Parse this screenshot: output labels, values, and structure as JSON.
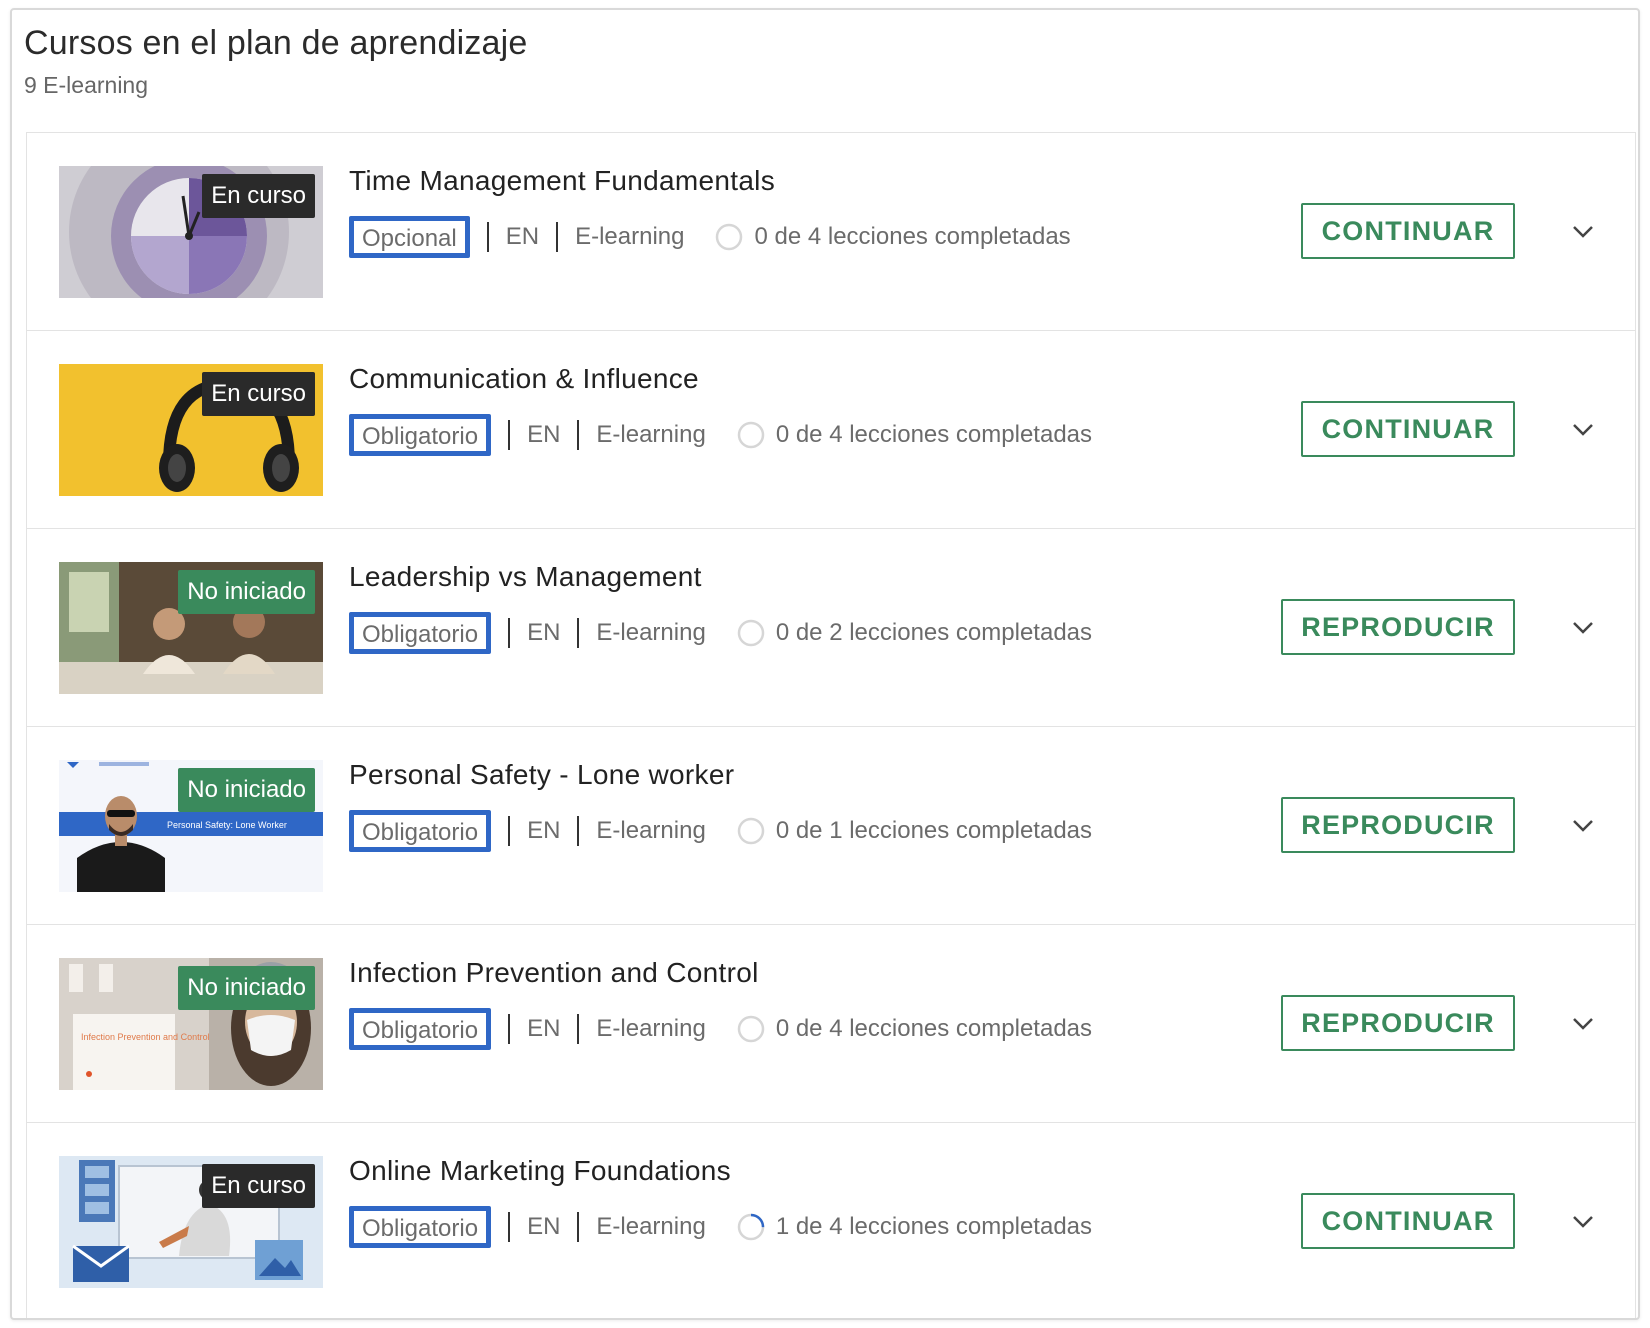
{
  "page": {
    "title": "Cursos en el plan de aprendizaje",
    "subtitle": "9 E-learning"
  },
  "icons": {
    "progress": "progress-ring-icon",
    "expand": "chevron-down-icon"
  },
  "colors": {
    "accent_green": "#3a8a5c",
    "status_in_progress_bg": "#2a2a2a",
    "status_not_started_bg": "#3a8a5c",
    "highlight_blue": "#2f67c6"
  },
  "courses": [
    {
      "title": "Time Management Fundamentals",
      "status": "En curso",
      "requirement": "Opcional",
      "language": "EN",
      "type": "E-learning",
      "progress_text": "0 de 4 lecciones completadas",
      "completed_lessons": 0,
      "total_lessons": 4,
      "action": "CONTINUAR"
    },
    {
      "title": "Communication & Influence",
      "status": "En curso",
      "requirement": "Obligatorio",
      "language": "EN",
      "type": "E-learning",
      "progress_text": "0 de 4 lecciones completadas",
      "completed_lessons": 0,
      "total_lessons": 4,
      "action": "CONTINUAR"
    },
    {
      "title": "Leadership vs Management",
      "status": "No iniciado",
      "requirement": "Obligatorio",
      "language": "EN",
      "type": "E-learning",
      "progress_text": "0 de 2 lecciones completadas",
      "completed_lessons": 0,
      "total_lessons": 2,
      "action": "REPRODUCIR"
    },
    {
      "title": "Personal Safety - Lone worker",
      "status": "No iniciado",
      "requirement": "Obligatorio",
      "language": "EN",
      "type": "E-learning",
      "progress_text": "0 de 1 lecciones completadas",
      "completed_lessons": 0,
      "total_lessons": 1,
      "action": "REPRODUCIR",
      "thumbnail_caption": "Personal Safety: Lone Worker"
    },
    {
      "title": "Infection Prevention and Control",
      "status": "No iniciado",
      "requirement": "Obligatorio",
      "language": "EN",
      "type": "E-learning",
      "progress_text": "0 de 4 lecciones completadas",
      "completed_lessons": 0,
      "total_lessons": 4,
      "action": "REPRODUCIR",
      "thumbnail_caption": "Infection Prevention and Control"
    },
    {
      "title": "Online Marketing Foundations",
      "status": "En curso",
      "requirement": "Obligatorio",
      "language": "EN",
      "type": "E-learning",
      "progress_text": "1 de 4 lecciones completadas",
      "completed_lessons": 1,
      "total_lessons": 4,
      "action": "CONTINUAR"
    }
  ]
}
